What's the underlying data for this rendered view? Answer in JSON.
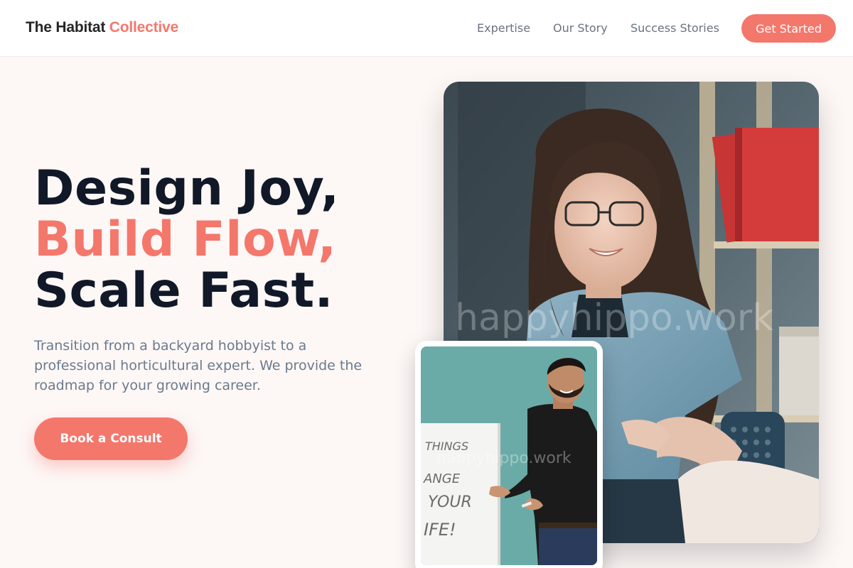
{
  "header": {
    "logo_part1": "The Habitat ",
    "logo_part2": "Collective",
    "nav": {
      "expertise": "Expertise",
      "story": "Our Story",
      "success": "Success Stories"
    },
    "cta": "Get Started"
  },
  "hero": {
    "headline_line1": "Design Joy,",
    "headline_line2": "Build Flow,",
    "headline_line3": "Scale Fast.",
    "subtitle": "Transition from a backyard hobbyist to a professional horticultural expert. We provide the roadmap for your growing career.",
    "cta": "Book a Consult"
  },
  "images": {
    "main_watermark": "happyhippo.work",
    "small_watermark": "happyhippo.work",
    "whiteboard_lines": [
      "THINGS",
      "ANGE",
      "YOUR",
      "IFE!"
    ]
  },
  "colors": {
    "accent": "#f4776c",
    "heading": "#111827",
    "body_text": "#6b7a8d",
    "background": "#fdf7f6"
  }
}
